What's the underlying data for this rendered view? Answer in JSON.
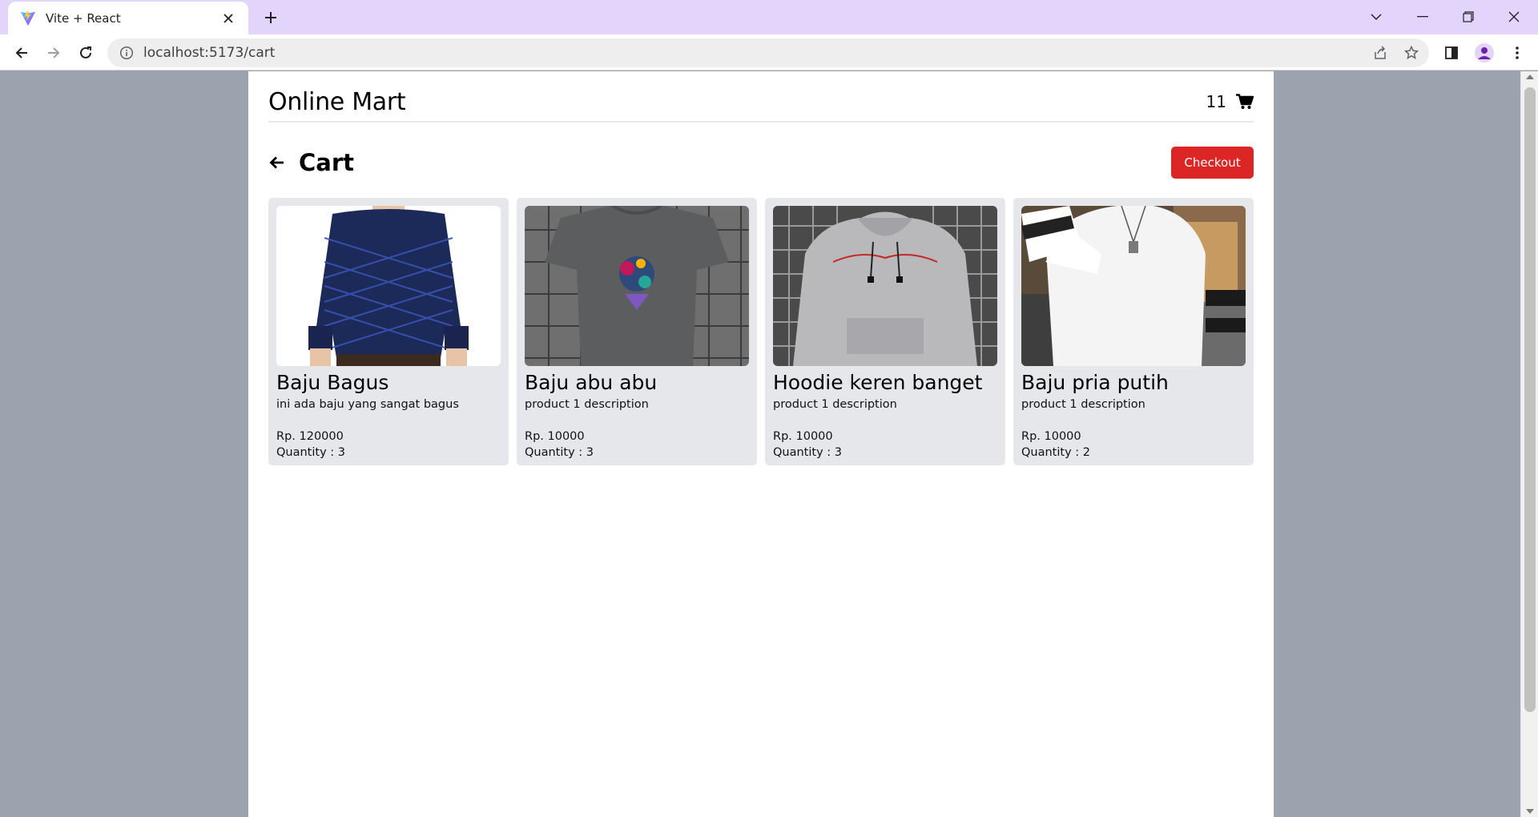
{
  "browser": {
    "tab_title": "Vite + React",
    "url": "localhost:5173/cart"
  },
  "header": {
    "brand": "Online Mart",
    "cart_count": "11"
  },
  "cart": {
    "title": "Cart",
    "checkout_label": "Checkout",
    "items": [
      {
        "name": "Baju Bagus",
        "description": "ini ada baju yang sangat bagus",
        "price": "Rp. 120000",
        "quantity": "Quantity : 3"
      },
      {
        "name": "Baju abu abu",
        "description": "product 1 description",
        "price": "Rp. 10000",
        "quantity": "Quantity : 3"
      },
      {
        "name": "Hoodie keren banget",
        "description": "product 1 description",
        "price": "Rp. 10000",
        "quantity": "Quantity : 3"
      },
      {
        "name": "Baju pria putih",
        "description": "product 1 description",
        "price": "Rp. 10000",
        "quantity": "Quantity : 2"
      }
    ]
  },
  "colors": {
    "accent_button": "#dc2626",
    "card_bg": "#e5e7eb",
    "page_bg": "#9ca3af",
    "tabbar_bg": "#e3d4fc"
  }
}
